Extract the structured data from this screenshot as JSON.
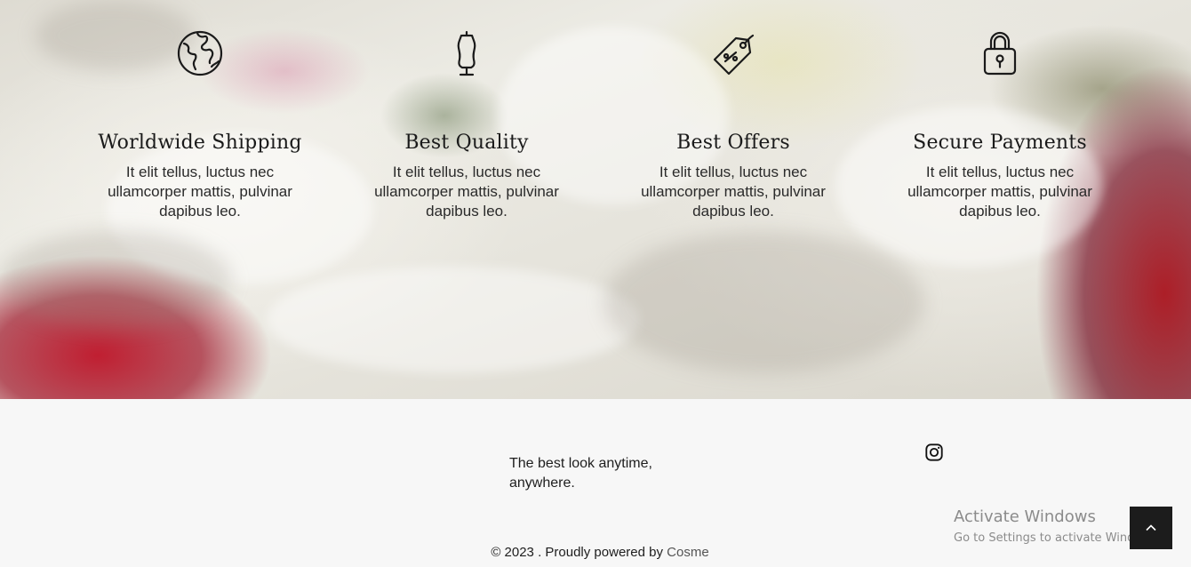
{
  "features": [
    {
      "icon": "globe-icon",
      "title": "Worldwide Shipping",
      "text": "It elit tellus, luctus nec ullamcorper mattis, pulvinar dapibus leo."
    },
    {
      "icon": "dress-form-icon",
      "title": "Best Quality",
      "text": "It elit tellus, luctus nec ullamcorper mattis, pulvinar dapibus leo."
    },
    {
      "icon": "price-tag-icon",
      "title": "Best Offers",
      "text": "It elit tellus, luctus nec ullamcorper mattis, pulvinar dapibus leo."
    },
    {
      "icon": "padlock-icon",
      "title": "Secure Payments",
      "text": "It elit tellus, luctus nec ullamcorper mattis, pulvinar dapibus leo."
    }
  ],
  "footer": {
    "tagline": "The best look anytime, anywhere.",
    "social_icon": "instagram-icon",
    "copyright_prefix": "© 2023 . Proudly powered by ",
    "copyright_link": "Cosme"
  },
  "watermark": {
    "title": "Activate Windows",
    "subtitle": "Go to Settings to activate Windows."
  },
  "back_to_top_icon": "chevron-up-icon"
}
